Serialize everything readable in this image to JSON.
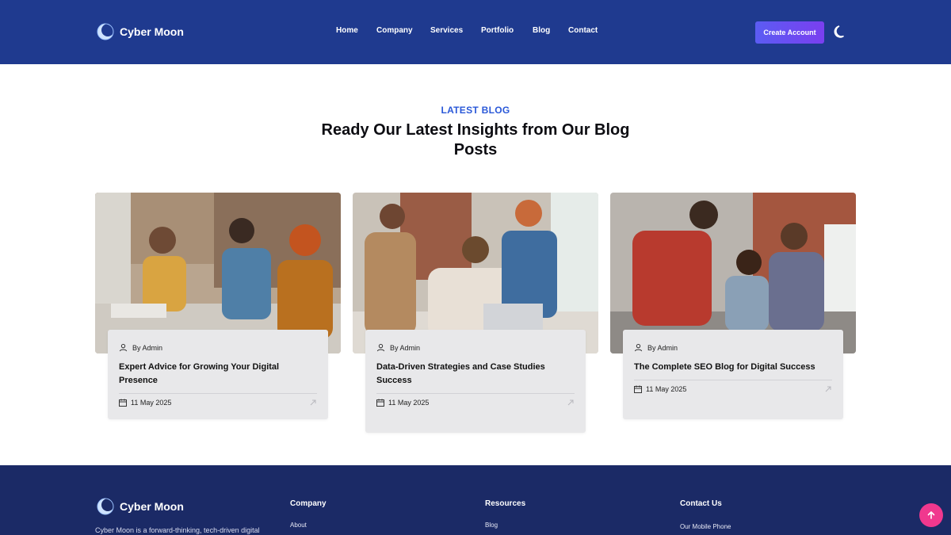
{
  "header": {
    "brand": "Cyber Moon",
    "nav": [
      "Home",
      "Company",
      "Services",
      "Portfolio",
      "Blog",
      "Contact"
    ],
    "create_account": "Create Account"
  },
  "section": {
    "tag": "LATEST BLOG",
    "title": "Ready Our Latest Insights from Our Blog Posts"
  },
  "posts": [
    {
      "author": "By Admin",
      "title": "Expert Advice for Growing Your Digital Presence",
      "date": "11 May 2025"
    },
    {
      "author": "By Admin",
      "title": "Data-Driven Strategies and Case Studies Success",
      "date": "11 May 2025"
    },
    {
      "author": "By Admin",
      "title": "The Complete SEO Blog for Digital Success",
      "date": "11 May 2025"
    }
  ],
  "footer": {
    "brand": "Cyber Moon",
    "description": "Cyber Moon is a forward-thinking, tech-driven digital",
    "columns": [
      {
        "heading": "Company",
        "first_link": "About"
      },
      {
        "heading": "Resources",
        "first_link": "Blog"
      },
      {
        "heading": "Contact Us",
        "first_link": "Our Mobile Phone"
      }
    ]
  },
  "colors": {
    "header_bg": "#1f3a8f",
    "footer_bg": "#1b2a66",
    "accent": "#2a58d8",
    "button": "#6a4ef2",
    "scroll_top": "#f0388e"
  },
  "icons": [
    "moon-logo-icon",
    "dark-mode-toggle-icon",
    "user-icon",
    "calendar-icon",
    "arrow-up-right-icon",
    "arrow-up-icon"
  ]
}
